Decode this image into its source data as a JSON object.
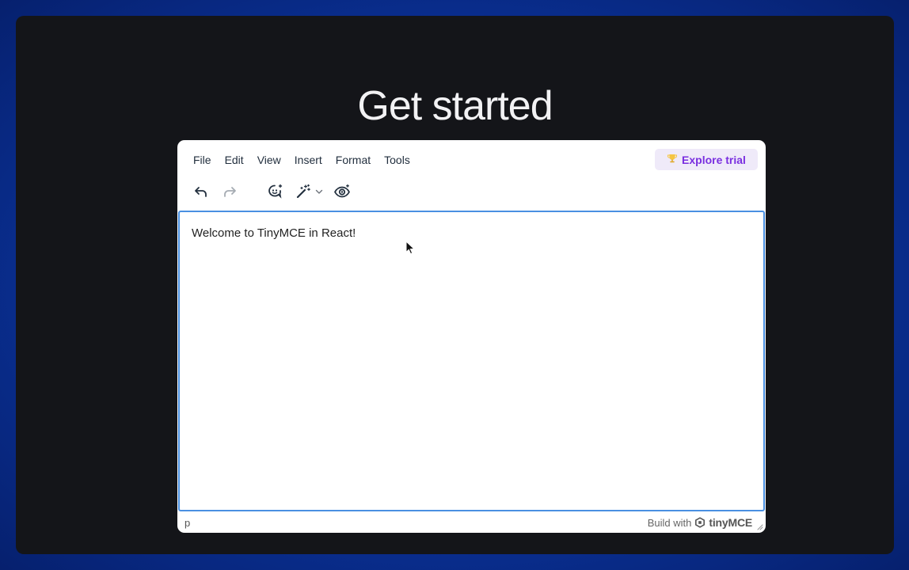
{
  "page": {
    "title": "Get started"
  },
  "editor": {
    "menu": [
      "File",
      "Edit",
      "View",
      "Insert",
      "Format",
      "Tools"
    ],
    "trial_button": {
      "icon": "trophy-icon",
      "label": "Explore trial"
    },
    "toolbar": [
      {
        "name": "undo-icon"
      },
      {
        "name": "redo-icon"
      },
      {
        "name": "ai-assistant-icon"
      },
      {
        "name": "magic-wand-icon"
      },
      {
        "name": "chevron-down-icon"
      },
      {
        "name": "preview-eye-icon"
      }
    ],
    "content": {
      "text": "Welcome to TinyMCE in React!"
    },
    "status": {
      "path": "p",
      "branding_prefix": "Build with",
      "brand": "tinyMCE"
    }
  },
  "colors": {
    "background_blue": "#0b35a0",
    "window": "#141519",
    "focus_border": "#4a90e2",
    "trial_text": "#7a2fe0",
    "trial_bg": "#efeaf9"
  }
}
